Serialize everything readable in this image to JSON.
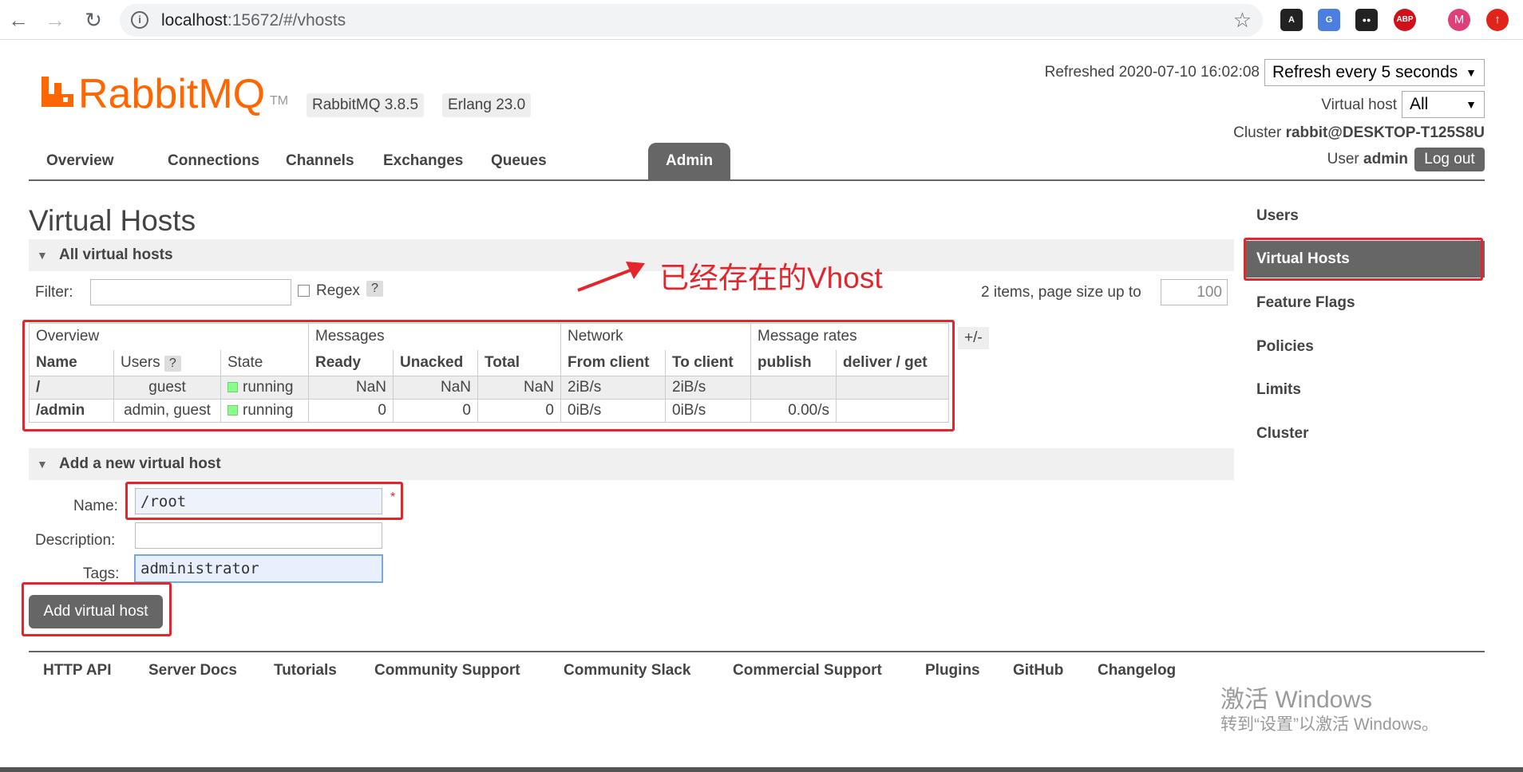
{
  "browser": {
    "url_host": "localhost",
    "url_rest": ":15672/#/vhosts",
    "back_icon": "arrow-left",
    "forward_icon": "arrow-right",
    "reload_icon": "reload",
    "extensions": [
      {
        "name": "ext-astar",
        "label": "A",
        "color": "#222222"
      },
      {
        "name": "ext-translate",
        "label": "G",
        "color": "#4a7fe0"
      },
      {
        "name": "ext-tampermonkey",
        "label": "●●",
        "color": "#222222"
      },
      {
        "name": "ext-adblock",
        "label": "ABP",
        "color": "#d0111a"
      },
      {
        "name": "ext-profile",
        "label": "M",
        "color": "#e0407a"
      },
      {
        "name": "ext-update",
        "label": "↑",
        "color": "#e0241b"
      }
    ]
  },
  "header": {
    "logo_word": "RabbitMQ",
    "logo_tm": "TM",
    "version_badges": [
      "RabbitMQ 3.8.5",
      "Erlang 23.0"
    ],
    "refreshed": "Refreshed 2020-07-10 16:02:08",
    "refresh_select": "Refresh every 5 seconds",
    "vhost_label": "Virtual host",
    "vhost_select": "All",
    "cluster_label": "Cluster",
    "cluster_name": "rabbit@DESKTOP-T125S8U",
    "user_label": "User",
    "user_name": "admin",
    "logout": "Log out",
    "brand_color": "#ff6600"
  },
  "tabs": [
    "Overview",
    "Connections",
    "Channels",
    "Exchanges",
    "Queues",
    "Admin"
  ],
  "active_tab": "Admin",
  "right_menu": [
    "Users",
    "Virtual Hosts",
    "Feature Flags",
    "Policies",
    "Limits",
    "Cluster"
  ],
  "right_menu_active": "Virtual Hosts",
  "page_title": "Virtual Hosts",
  "all_vhosts": {
    "section_title": "All virtual hosts",
    "filter_label": "Filter:",
    "filter_value": "",
    "regex_label": "Regex",
    "help": "?",
    "items_text": "2 items, page size up to",
    "page_size": "100",
    "table": {
      "groups": [
        "Overview",
        "Messages",
        "Network",
        "Message rates"
      ],
      "columns": [
        "Name",
        "Users",
        "State",
        "Ready",
        "Unacked",
        "Total",
        "From client",
        "To client",
        "publish",
        "deliver / get"
      ],
      "rows": [
        {
          "name": "/",
          "users": "guest",
          "state": "running",
          "ready": "NaN",
          "unacked": "NaN",
          "total": "NaN",
          "from_client": "2iB/s",
          "to_client": "2iB/s",
          "publish": "",
          "deliver_get": ""
        },
        {
          "name": "/admin",
          "users": "admin, guest",
          "state": "running",
          "ready": "0",
          "unacked": "0",
          "total": "0",
          "from_client": "0iB/s",
          "to_client": "0iB/s",
          "publish": "0.00/s",
          "deliver_get": ""
        }
      ],
      "plus_minus": "+/-"
    }
  },
  "add_vhost": {
    "section_title": "Add a new virtual host",
    "name_label": "Name:",
    "name_value": "/root",
    "required_mark": "*",
    "description_label": "Description:",
    "description_value": "",
    "tags_label": "Tags:",
    "tags_value": "administrator",
    "submit": "Add virtual host"
  },
  "annotation": {
    "text": "已经存在的Vhost",
    "color": "#e4262c"
  },
  "footer_links": [
    "HTTP API",
    "Server Docs",
    "Tutorials",
    "Community Support",
    "Community Slack",
    "Commercial Support",
    "Plugins",
    "GitHub",
    "Changelog"
  ],
  "watermark": {
    "line1": "激活 Windows",
    "line2": "转到“设置”以激活 Windows。"
  }
}
